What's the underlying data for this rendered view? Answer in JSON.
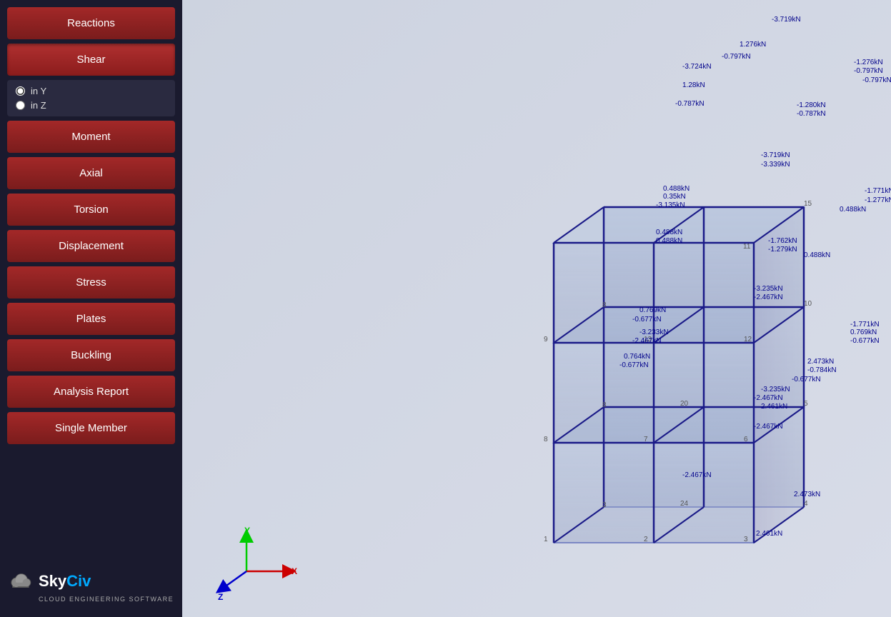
{
  "sidebar": {
    "buttons": [
      {
        "id": "reactions",
        "label": "Reactions",
        "active": false
      },
      {
        "id": "shear",
        "label": "Shear",
        "active": true
      },
      {
        "id": "moment",
        "label": "Moment",
        "active": false
      },
      {
        "id": "axial",
        "label": "Axial",
        "active": false
      },
      {
        "id": "torsion",
        "label": "Torsion",
        "active": false
      },
      {
        "id": "displacement",
        "label": "Displacement",
        "active": false
      },
      {
        "id": "stress",
        "label": "Stress",
        "active": false
      },
      {
        "id": "plates",
        "label": "Plates",
        "active": false
      },
      {
        "id": "buckling",
        "label": "Buckling",
        "active": false
      },
      {
        "id": "analysis-report",
        "label": "Analysis Report",
        "active": false
      },
      {
        "id": "single-member",
        "label": "Single Member",
        "active": false
      }
    ],
    "radio_options": [
      {
        "id": "in-y",
        "label": "in Y",
        "checked": true
      },
      {
        "id": "in-z",
        "label": "in Z",
        "checked": false
      }
    ]
  },
  "logo": {
    "brand": "SkyCiv",
    "subtitle": "CLOUD ENGINEERING SOFTWARE"
  },
  "axes": {
    "x_label": "X",
    "y_label": "Y",
    "z_label": "Z"
  }
}
